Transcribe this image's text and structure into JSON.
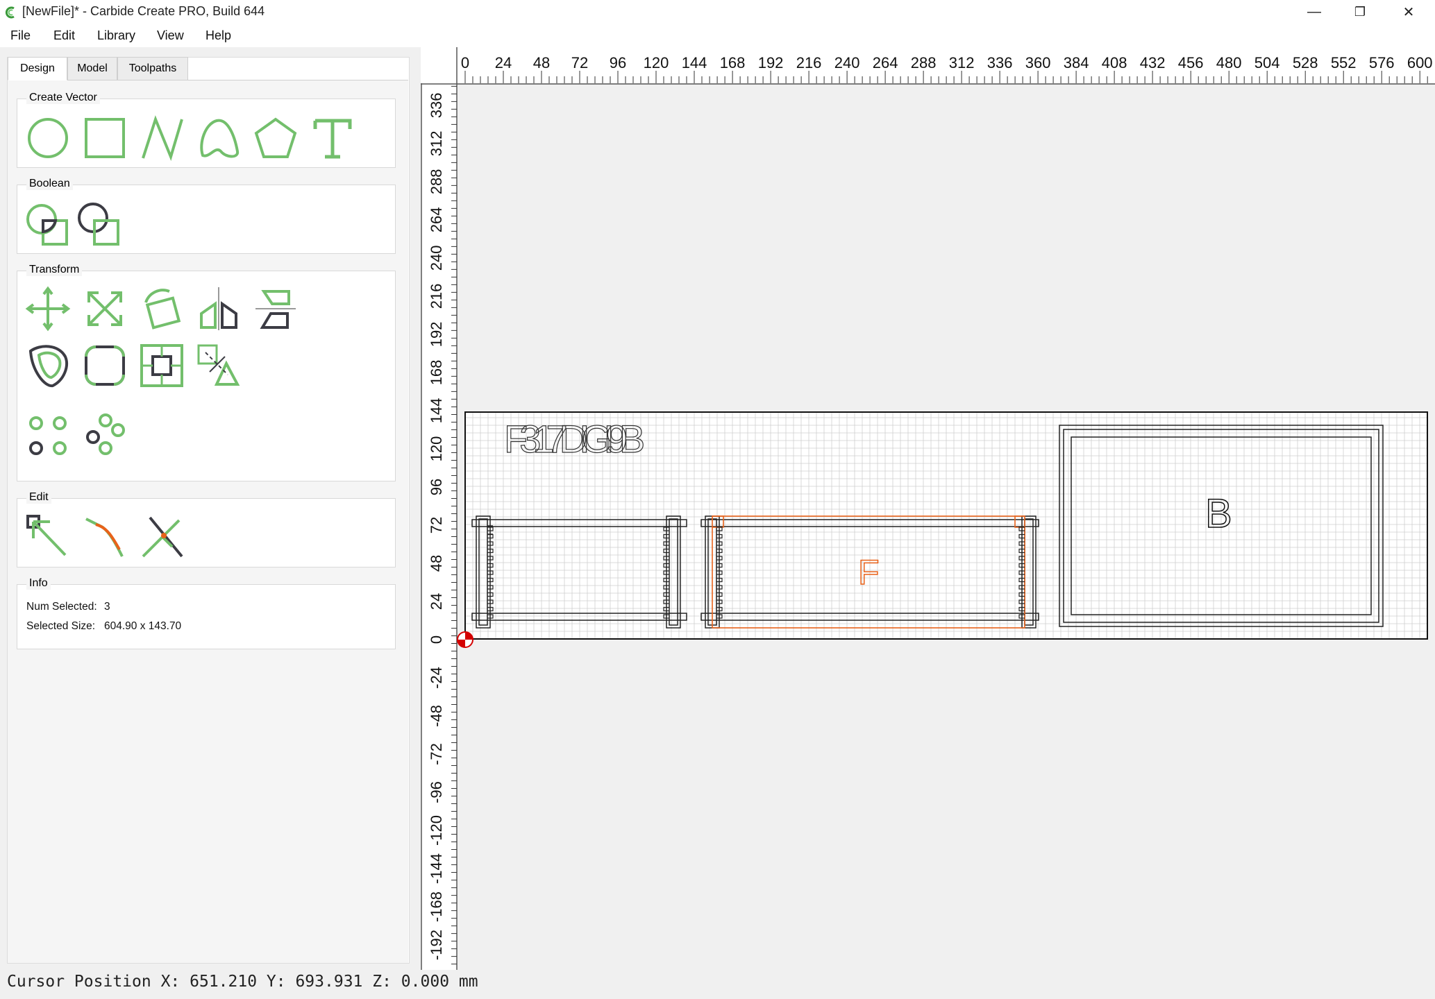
{
  "window": {
    "title": "[NewFile]* - Carbide Create PRO, Build 644",
    "minimize_glyph": "—",
    "restore_glyph": "❐",
    "close_glyph": "✕"
  },
  "menu": [
    "File",
    "Edit",
    "Library",
    "View",
    "Help"
  ],
  "tabs": [
    "Design",
    "Model",
    "Toolpaths"
  ],
  "active_tab": "Design",
  "groups": {
    "create_vector": {
      "title": "Create Vector",
      "tools": [
        "circle-tool-icon",
        "rectangle-tool-icon",
        "polyline-tool-icon",
        "curve-tool-icon",
        "polygon-tool-icon",
        "text-tool-icon"
      ]
    },
    "boolean": {
      "title": "Boolean",
      "tools": [
        "boolean-union-icon",
        "boolean-subtract-icon"
      ]
    },
    "transform": {
      "title": "Transform",
      "tools": [
        "move-icon",
        "scale-icon",
        "rotate-icon",
        "mirror-icon",
        "align-icon",
        "offset-icon",
        "fillet-icon",
        "center-icon",
        "trim-icon",
        "grid-array-icon",
        "circular-array-icon"
      ]
    },
    "edit": {
      "title": "Edit",
      "tools": [
        "node-edit-icon",
        "smooth-node-icon",
        "cut-node-icon"
      ]
    },
    "info": {
      "title": "Info",
      "num_selected_label": "Num Selected:",
      "num_selected_value": "3",
      "selected_size_label": "Selected Size:",
      "selected_size_value": "604.90 x 143.70"
    }
  },
  "ruler": {
    "x_labels": [
      "0",
      "24",
      "48",
      "72",
      "96",
      "120",
      "144",
      "168",
      "192",
      "216",
      "240",
      "264",
      "288",
      "312",
      "336",
      "360",
      "384",
      "408",
      "432",
      "456",
      "480",
      "504",
      "528",
      "552",
      "576",
      "600"
    ],
    "y_labels": [
      "336",
      "312",
      "288",
      "264",
      "240",
      "216",
      "192",
      "168",
      "144",
      "120",
      "96",
      "72",
      "48",
      "24",
      "0",
      "-24",
      "-48",
      "-72",
      "-96",
      "-120",
      "-144",
      "-168",
      "-192"
    ]
  },
  "canvas": {
    "text_overlap": "F317DIGI9B",
    "letter_f": "F",
    "letter_b": "B",
    "accent": "#e8621a",
    "tool_green": "#73bf6c",
    "tool_dark": "#3c3c44"
  },
  "status": {
    "label": "Cursor Position",
    "x": "X: 651.210",
    "y": "Y: 693.931",
    "z": "Z: 0.000",
    "unit": "mm"
  }
}
